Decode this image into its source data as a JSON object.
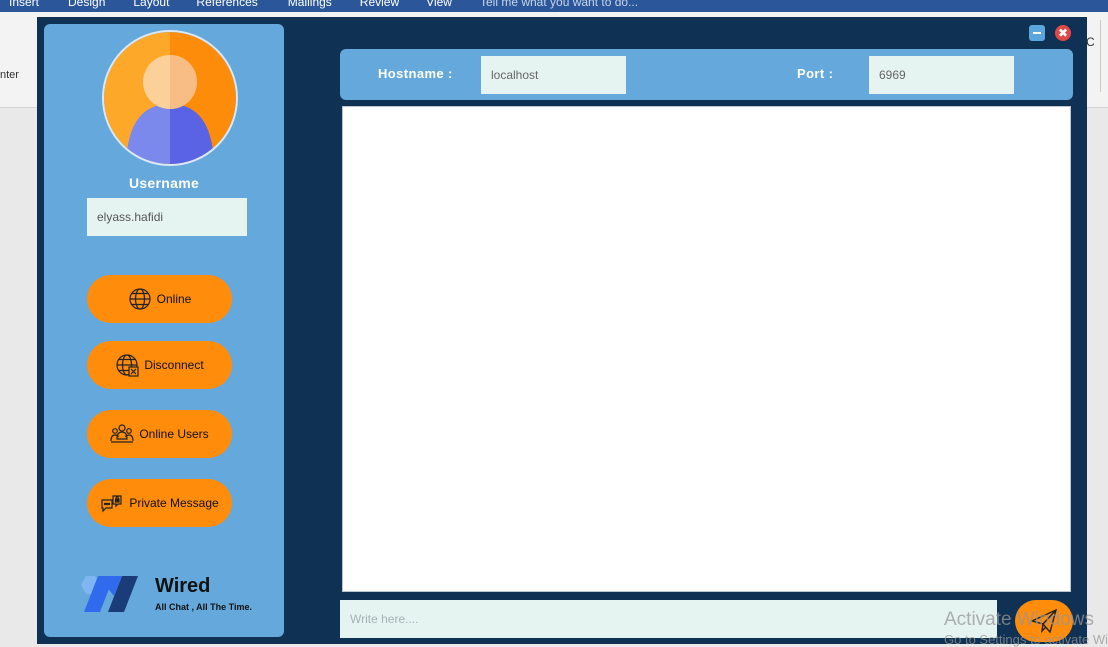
{
  "ribbon": {
    "tabs": [
      "Insert",
      "Design",
      "Layout",
      "References",
      "Mailings",
      "Review",
      "View"
    ],
    "tell_me": "Tell me what you want to do...",
    "enter_text": "nter",
    "c_letter": "C"
  },
  "sidebar": {
    "username_label": "Username",
    "username_value": "elyass.hafidi",
    "buttons": {
      "online": "Online",
      "disconnect": "Disconnect",
      "online_users": "Online Users",
      "private_message": "Private Message"
    },
    "logo": {
      "name": "Wired",
      "tagline": "All Chat , All The Time."
    }
  },
  "window": {
    "minimize_icon": "minimize-icon",
    "close_icon": "close-icon",
    "close_glyph": "✖"
  },
  "connection": {
    "hostname_label": "Hostname :",
    "hostname_value": "localhost",
    "port_label": "Port :",
    "port_value": "6969"
  },
  "chat": {
    "input_placeholder": "Write here....",
    "send_icon": "send-icon"
  },
  "watermark": {
    "line1": "Activate Windows",
    "line2": "Go to Settings to activate Windows."
  },
  "colors": {
    "app_bg": "#0f3153",
    "panel": "#65a9dc",
    "accent": "#ff8c0a",
    "field_bg": "#e6f4f1"
  }
}
